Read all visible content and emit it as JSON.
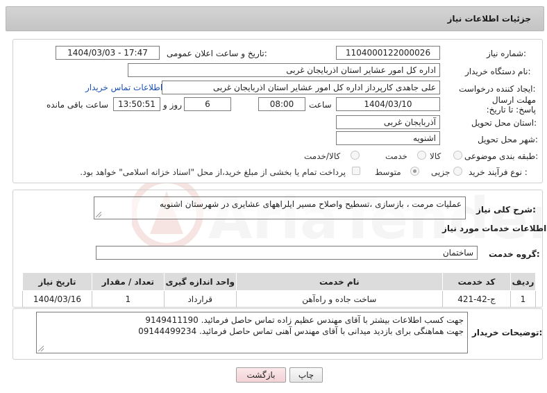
{
  "header": {
    "title": "جزئیات اطلاعات نیاز"
  },
  "form": {
    "need_number_label": "شماره نیاز:",
    "need_number": "1104000122000026",
    "announce_label": "تاریخ و ساعت اعلان عمومی:",
    "announce_value": "1404/03/03 - 17:47",
    "buyer_label": "نام دستگاه خریدار:",
    "buyer_value": "اداره کل امور عشایر استان اذربایجان غربی",
    "creator_label": "ایجاد کننده درخواست:",
    "creator_value": "علی جاهدی کارپرداز اداره کل امور عشایر استان اذربایجان غربی",
    "contact_link": "اطلاعات تماس خریدار",
    "deadline_label": "مهلت ارسال پاسخ: تا تاریخ:",
    "deadline_date": "1404/03/10",
    "time_label": "ساعت",
    "deadline_time": "08:00",
    "days_value": "6",
    "days_label": "روز و",
    "remaining_time": "13:50:51",
    "remaining_label": "ساعت باقی مانده",
    "province_label": "استان محل تحویل:",
    "province_value": "آذربایجان غربی",
    "city_label": "شهر محل تحویل:",
    "city_value": "اشنویه",
    "category_label": "طبقه بندی موضوعی:",
    "category_options": [
      "کالا",
      "خدمت",
      "کالا/خدمت"
    ],
    "process_label": "نوع فرآیند خرید :",
    "process_options": [
      "جزیی",
      "متوسط"
    ],
    "payment_text": "پرداخت تمام یا بخشی از مبلغ خرید،از محل \"اسناد خزانه اسلامی\" خواهد بود."
  },
  "summary": {
    "label": "شرح کلی نیاز:",
    "value": "عملیات مرمت ، بازسازی ،تسطیح واصلاح مسیر ایلراههای عشایری در شهرستان اشنویه"
  },
  "services": {
    "title": "اطلاعات خدمات مورد نیاز",
    "group_label": "گروه خدمت:",
    "group_value": "ساختمان",
    "columns": [
      "ردیف",
      "کد خدمت",
      "نام خدمت",
      "واحد اندازه گیری",
      "تعداد / مقدار",
      "تاریخ نیاز"
    ],
    "rows": [
      [
        "1",
        "ج-42-421",
        "ساخت جاده و راه‌آهن",
        "قرارداد",
        "1",
        "1404/03/16"
      ]
    ]
  },
  "buyer_notes": {
    "label": "توضیحات خریدار:",
    "line1": "جهت کسب اطلاعات بیشتر با آقای مهندس عظیم زاده تماس حاصل فرمائید. 9149411190",
    "line2": "جهت هماهنگی برای بازدید میدانی با آقای مهندس آهنی تماس حاصل فرمائید. 09144499234"
  },
  "buttons": {
    "print": "چاپ",
    "back": "بازگشت"
  },
  "watermark": {
    "text": "AriaTender.neT"
  }
}
